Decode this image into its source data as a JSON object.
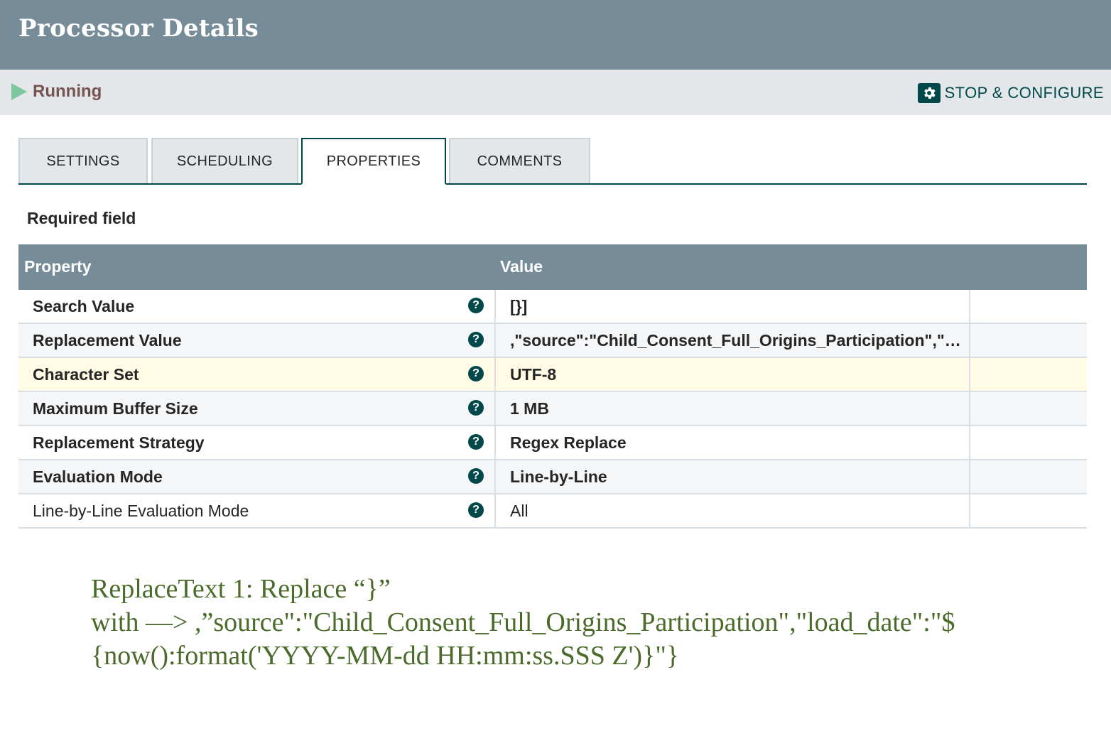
{
  "header": {
    "title": "Processor Details"
  },
  "status": {
    "state": "Running",
    "action_label": "STOP & CONFIGURE",
    "run_color": "#7dc7a0",
    "accent_color": "#004849"
  },
  "tabs": [
    {
      "label": "SETTINGS",
      "active": false
    },
    {
      "label": "SCHEDULING",
      "active": false
    },
    {
      "label": "PROPERTIES",
      "active": true
    },
    {
      "label": "COMMENTS",
      "active": false
    }
  ],
  "required_label": "Required field",
  "table": {
    "headers": {
      "property": "Property",
      "value": "Value"
    },
    "rows": [
      {
        "property": "Search Value",
        "value": "[}]",
        "required": true
      },
      {
        "property": "Replacement Value",
        "value": ",\"source\":\"Child_Consent_Full_Origins_Participation\",\"load_...",
        "required": true
      },
      {
        "property": "Character Set",
        "value": "UTF-8",
        "required": true
      },
      {
        "property": "Maximum Buffer Size",
        "value": "1 MB",
        "required": true
      },
      {
        "property": "Replacement Strategy",
        "value": "Regex Replace",
        "required": true
      },
      {
        "property": "Evaluation Mode",
        "value": "Line-by-Line",
        "required": true
      },
      {
        "property": "Line-by-Line Evaluation Mode",
        "value": "All",
        "required": false
      }
    ]
  },
  "note": {
    "line1": "ReplaceText 1: Replace “}”",
    "line2": "with —>   ,”source\":\"Child_Consent_Full_Origins_Participation\",\"load_date\":\"$",
    "line3": "{now():format('YYYY-MM-dd HH:mm:ss.SSS Z')}\"}"
  }
}
